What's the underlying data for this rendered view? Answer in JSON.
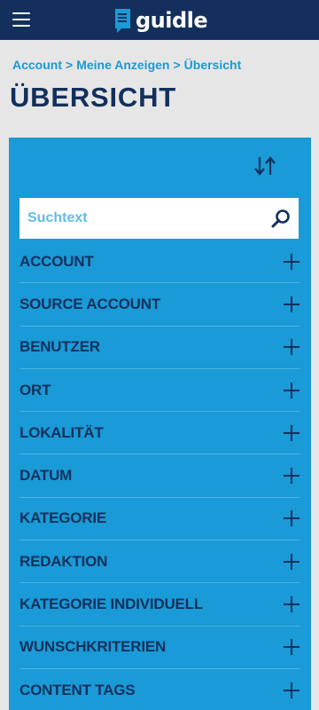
{
  "header": {
    "menu_icon": "hamburger-menu-icon",
    "logo_icon": "guidle-logo-icon",
    "logo_text": "guidle",
    "background": "#13305c"
  },
  "breadcrumb": [
    {
      "label": "Account"
    },
    {
      "label": "Meine Anzeigen"
    },
    {
      "label": "Übersicht"
    }
  ],
  "breadcrumb_separator": ">",
  "page": {
    "title": "ÜBERSICHT"
  },
  "panel": {
    "background": "#1a9ad6",
    "sort_icon": "sort-arrows-icon",
    "search": {
      "placeholder": "Suchtext",
      "value": "",
      "icon": "search-icon"
    },
    "filters": [
      {
        "label": "ACCOUNT",
        "icon": "plus-icon"
      },
      {
        "label": "SOURCE ACCOUNT",
        "icon": "plus-icon"
      },
      {
        "label": "BENUTZER",
        "icon": "plus-icon"
      },
      {
        "label": "ORT",
        "icon": "plus-icon"
      },
      {
        "label": "LOKALITÄT",
        "icon": "plus-icon"
      },
      {
        "label": "DATUM",
        "icon": "plus-icon"
      },
      {
        "label": "KATEGORIE",
        "icon": "plus-icon"
      },
      {
        "label": "REDAKTION",
        "icon": "plus-icon"
      },
      {
        "label": "KATEGORIE INDIVIDUELL",
        "icon": "plus-icon"
      },
      {
        "label": "WUNSCHKRITERIEN",
        "icon": "plus-icon"
      },
      {
        "label": "CONTENT TAGS",
        "icon": "plus-icon"
      }
    ]
  }
}
